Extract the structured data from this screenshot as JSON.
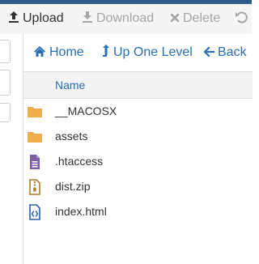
{
  "toolbar": {
    "upload_label": "Upload",
    "download_label": "Download",
    "delete_label": "Delete",
    "icons": {
      "upload": "upload-icon",
      "download": "download-icon",
      "delete": "close-icon",
      "undo": "undo-icon"
    },
    "disabled_color": "#a6a6a6"
  },
  "navbar": {
    "home_label": "Home",
    "up_label": "Up One Level",
    "back_label": "Back",
    "link_color": "#2a6fb0"
  },
  "table": {
    "columns": [
      "Name"
    ],
    "rows": [
      {
        "name": "__MACOSX",
        "type": "folder",
        "icon": "folder-icon"
      },
      {
        "name": "assets",
        "type": "folder",
        "icon": "folder-icon"
      },
      {
        "name": ".htaccess",
        "type": "text-file",
        "icon": "text-file-icon"
      },
      {
        "name": "dist.zip",
        "type": "zip-file",
        "icon": "zip-file-icon"
      },
      {
        "name": "index.html",
        "type": "html-file",
        "icon": "html-file-icon"
      }
    ]
  },
  "colors": {
    "folder": "#f0ad4e",
    "text_file": "#7b5ea7",
    "zip_file": "#b07a2a",
    "html_file": "#2a5ea8"
  }
}
